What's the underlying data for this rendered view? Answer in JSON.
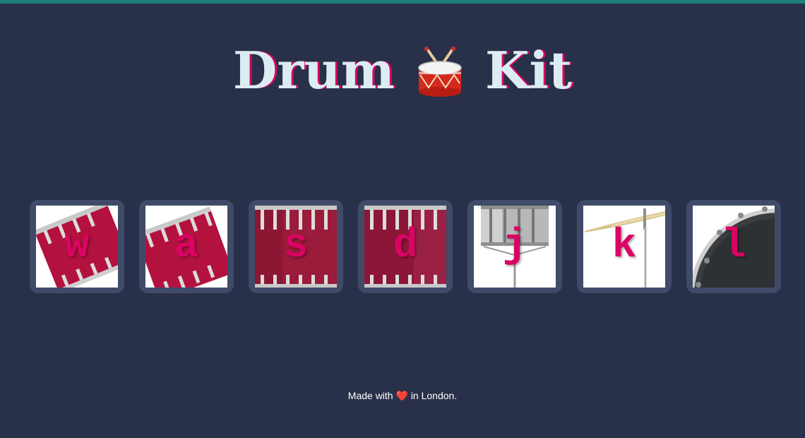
{
  "title": {
    "before": "Drum",
    "after": "Kit",
    "icon": "drum-emoji-icon"
  },
  "drums": [
    {
      "key": "w",
      "icon": "tom-1-icon"
    },
    {
      "key": "a",
      "icon": "tom-2-icon"
    },
    {
      "key": "s",
      "icon": "tom-3-icon"
    },
    {
      "key": "d",
      "icon": "tom-4-icon"
    },
    {
      "key": "j",
      "icon": "snare-icon"
    },
    {
      "key": "k",
      "icon": "crash-cymbal-icon"
    },
    {
      "key": "l",
      "icon": "kick-drum-icon"
    }
  ],
  "footer": {
    "before": "Made with",
    "heart": "❤️",
    "after": "in London."
  },
  "colors": {
    "background": "#283149",
    "tile": "#404b69",
    "accent": "#DA0463",
    "title": "#DBEDF3",
    "topbar": "#1f7f7a"
  }
}
